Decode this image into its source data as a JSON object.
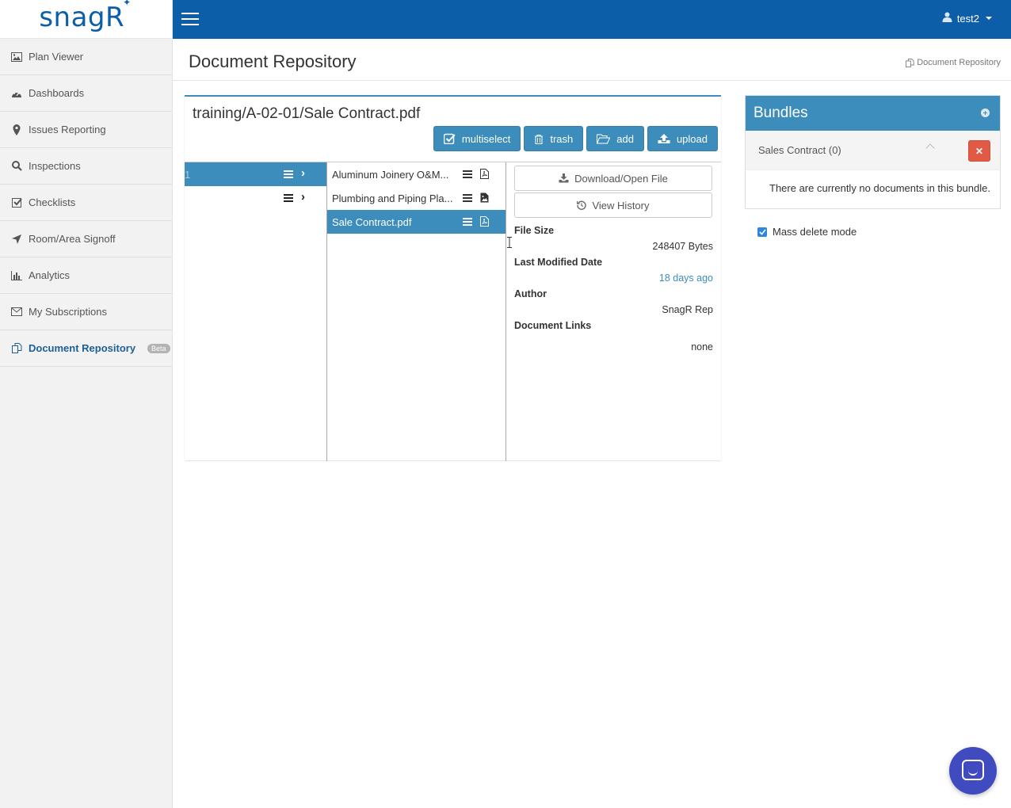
{
  "app": {
    "logo_text": "snag",
    "logo_mark": "R"
  },
  "topbar": {
    "user": "test2"
  },
  "sidebar": {
    "items": [
      {
        "label": "Plan Viewer",
        "icon": "image-icon"
      },
      {
        "label": "Dashboards",
        "icon": "dashboard-icon"
      },
      {
        "label": "Issues Reporting",
        "icon": "map-marker-icon"
      },
      {
        "label": "Inspections",
        "icon": "search-icon"
      },
      {
        "label": "Checklists",
        "icon": "check-square-icon"
      },
      {
        "label": "Room/Area Signoff",
        "icon": "location-arrow-icon"
      },
      {
        "label": "Analytics",
        "icon": "bar-chart-icon"
      },
      {
        "label": "My Subscriptions",
        "icon": "envelope-icon"
      },
      {
        "label": "Document Repository",
        "icon": "copy-icon",
        "badge": "Beta",
        "active": true
      }
    ]
  },
  "header": {
    "title": "Document Repository",
    "breadcrumb": "Document Repository"
  },
  "repo": {
    "path": "training/A-02-01/Sale Contract.pdf",
    "toolbar": {
      "multiselect": "multiselect",
      "trash": "trash",
      "add": "add",
      "upload": "upload"
    },
    "folders": [
      {
        "label": "1",
        "selected": true
      },
      {
        "label": "",
        "selected": false
      }
    ],
    "files": [
      {
        "label": "Aluminum Joinery O&M...",
        "type": "pdf",
        "selected": false
      },
      {
        "label": "Plumbing and Piping Pla...",
        "type": "image",
        "selected": false
      },
      {
        "label": "Sale Contract.pdf",
        "type": "pdf",
        "selected": true
      }
    ],
    "details": {
      "download_label": "Download/Open File",
      "history_label": "View History",
      "file_size_label": "File Size",
      "file_size_value": "248407 Bytes",
      "modified_label": "Last Modified Date",
      "modified_value": "18 days ago",
      "author_label": "Author",
      "author_value": "SnagR Rep",
      "links_label": "Document Links",
      "links_value": "none"
    }
  },
  "bundles": {
    "title": "Bundles",
    "items": [
      {
        "label": "Sales Contract (0)"
      }
    ],
    "empty_text": "There are currently no documents in this bundle.",
    "mass_delete_label": "Mass delete mode",
    "mass_delete_checked": true
  },
  "colors": {
    "brand": "#0d5ea8",
    "accent": "#3c8dbc",
    "danger": "#e05a46",
    "chat": "#3f4bbf"
  }
}
